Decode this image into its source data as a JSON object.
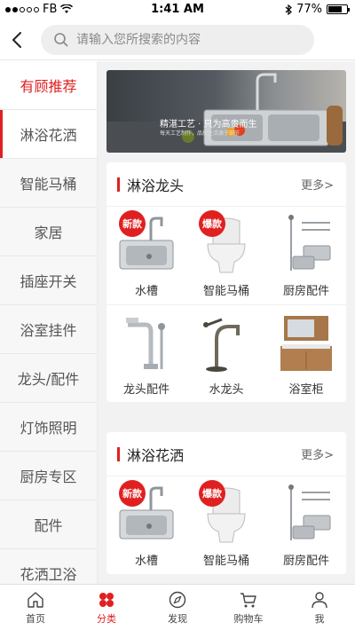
{
  "status": {
    "carrier": "FB",
    "time": "1:41 AM",
    "battery": "77%",
    "battery_level": 0.77
  },
  "search": {
    "placeholder": "请输入您所搜索的内容"
  },
  "sidebar": {
    "items": [
      {
        "label": "有顾推荐"
      },
      {
        "label": "淋浴花洒"
      },
      {
        "label": "智能马桶"
      },
      {
        "label": "家居"
      },
      {
        "label": "插座开关"
      },
      {
        "label": "浴室挂件"
      },
      {
        "label": "龙头/配件"
      },
      {
        "label": "灯饰照明"
      },
      {
        "label": "厨房专区"
      },
      {
        "label": "配件"
      },
      {
        "label": "花洒卫浴"
      }
    ]
  },
  "banner": {
    "headline": "精湛工艺 · 只为高贵而生",
    "subline": "每天工艺制作，品质生活源于细节"
  },
  "sections": [
    {
      "title": "淋浴龙头",
      "more": "更多>",
      "products": [
        {
          "label": "水槽",
          "badge": "新款",
          "icon": "sink-icon"
        },
        {
          "label": "智能马桶",
          "badge": "爆款",
          "icon": "toilet-icon"
        },
        {
          "label": "厨房配件",
          "badge": "",
          "icon": "rack-icon"
        },
        {
          "label": "龙头配件",
          "badge": "",
          "icon": "faucet-parts-icon"
        },
        {
          "label": "水龙头",
          "badge": "",
          "icon": "faucet-icon"
        },
        {
          "label": "浴室柜",
          "badge": "",
          "icon": "cabinet-icon"
        }
      ]
    },
    {
      "title": "淋浴花洒",
      "more": "更多>",
      "products": [
        {
          "label": "水槽",
          "badge": "新款",
          "icon": "sink-icon"
        },
        {
          "label": "智能马桶",
          "badge": "爆款",
          "icon": "toilet-icon"
        },
        {
          "label": "厨房配件",
          "badge": "",
          "icon": "rack-icon"
        }
      ]
    }
  ],
  "tabs": [
    {
      "label": "首页",
      "icon": "home-icon"
    },
    {
      "label": "分类",
      "icon": "category-icon"
    },
    {
      "label": "发现",
      "icon": "compass-icon"
    },
    {
      "label": "购物车",
      "icon": "cart-icon"
    },
    {
      "label": "我",
      "icon": "user-icon"
    }
  ],
  "colors": {
    "accent": "#e02020",
    "background": "#f2f2f2"
  }
}
